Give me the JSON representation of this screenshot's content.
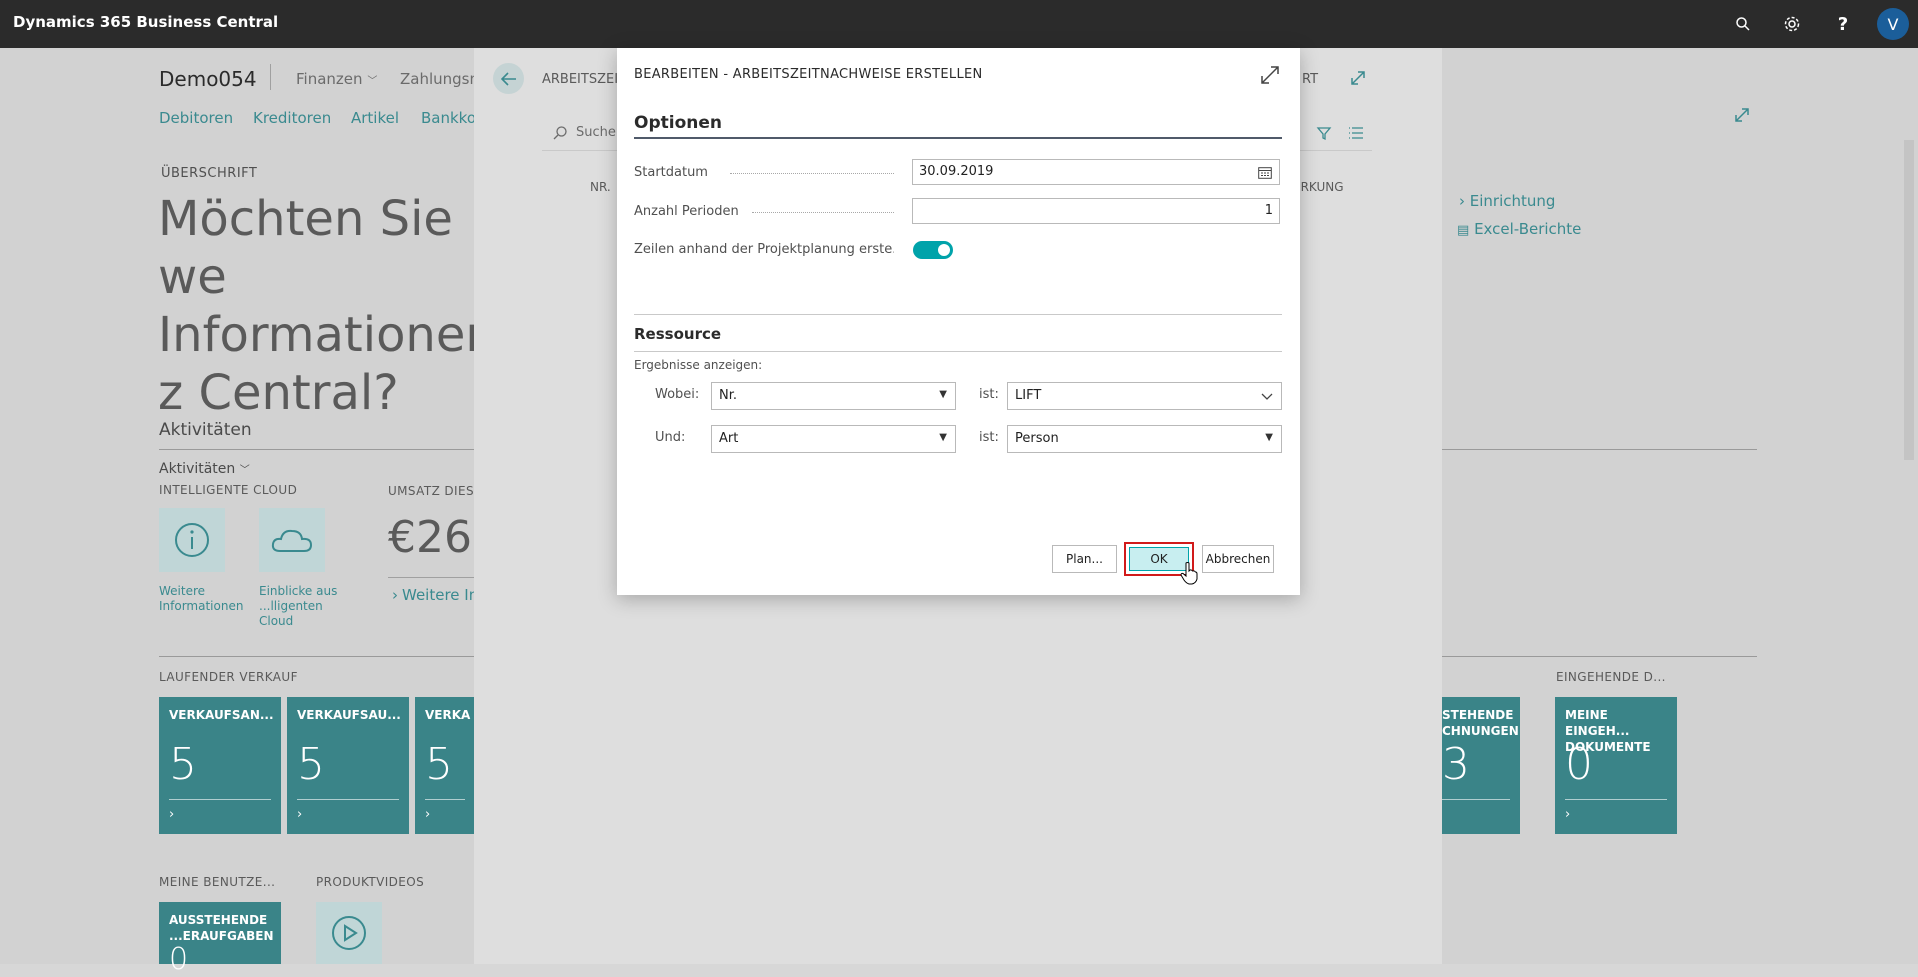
{
  "app": {
    "title": "Dynamics 365 Business Central",
    "user_initial": "V"
  },
  "topbar_icons": [
    "search-icon",
    "gear-icon",
    "help-icon"
  ],
  "background": {
    "company": "Demo054",
    "menu": [
      "Finanzen",
      "Zahlungsm"
    ],
    "nav_links": [
      "Debitoren",
      "Kreditoren",
      "Artikel",
      "Bankko"
    ],
    "headline_caption": "ÜBERSCHRIFT",
    "headline": "Möchten Sie we Informationen z Central?",
    "activities_title": "Aktivitäten",
    "activities_dropdown": "Aktivitäten",
    "intelligent_cloud": "INTELLIGENTE CLOUD",
    "tile_more_info": "Weitere Informationen",
    "tile_insights": "Einblicke aus ...lligenten Cloud",
    "umsatz_label": "UMSATZ DIES",
    "umsatz_value": "€26",
    "weitere_link": "Weitere In",
    "laufender_verkauf": "LAUFENDER VERKAUF",
    "eingehende_label": "EINGEHENDE D...",
    "cue_tiles": [
      {
        "title": "VERKAUFSAN...",
        "value": "5"
      },
      {
        "title": "VERKAUFSAU...",
        "value": "5"
      },
      {
        "title": "VERKA",
        "value": "5"
      }
    ],
    "right_cue": {
      "title": "STEHENDE CHNUNGEN",
      "value": "3"
    },
    "incoming_cue": {
      "title": "MEINE EINGEH... DOKUMENTE",
      "value": "0"
    },
    "meine_benutzer": "MEINE BENUTZE...",
    "produktvideos": "PRODUKTVIDEOS",
    "pending_tile": {
      "title": "AUSSTEHENDE ...ERAUFGABEN",
      "value": "0"
    },
    "right_links": [
      "Einrichtung",
      "Excel-Berichte"
    ]
  },
  "panel": {
    "title": "ARBEITSZEI",
    "title_right": "RT",
    "search_placeholder": "Suchen",
    "col_nr": "NR.",
    "col_right": "ERKUNG"
  },
  "dialog": {
    "title": "BEARBEITEN - ARBEITSZEITNACHWEISE ERSTELLEN",
    "options_title": "Optionen",
    "fields": [
      {
        "label": "Startdatum",
        "value": "30.09.2019"
      },
      {
        "label": "Anzahl Perioden",
        "value": "1"
      }
    ],
    "toggle_label": "Zeilen anhand der Projektplanung erste...",
    "toggle_on": true,
    "resource_title": "Ressource",
    "results_label": "Ergebnisse anzeigen:",
    "filters": [
      {
        "prefix": "Wobei:",
        "field": "Nr.",
        "is_label": "ist:",
        "value": "LIFT"
      },
      {
        "prefix": "Und:",
        "field": "Art",
        "is_label": "ist:",
        "value": "Person"
      }
    ],
    "buttons": {
      "plan": "Plan...",
      "ok": "OK",
      "cancel": "Abbrechen"
    }
  },
  "colors": {
    "accent": "#00a3aa",
    "tile": "#3a8488",
    "highlight": "#d11a1a"
  }
}
